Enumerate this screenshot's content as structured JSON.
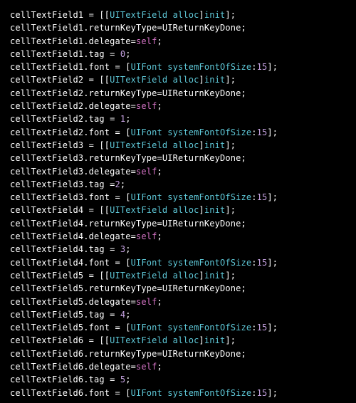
{
  "code": {
    "varPrefix": "cellTextField",
    "allocClass": "UITextField",
    "allocSel": "alloc",
    "initSel": "init",
    "returnKeyProp": "returnKeyType",
    "returnKeyValue": "UIReturnKeyDone",
    "delegateProp": "delegate",
    "selfKw": "self",
    "tagProp": "tag",
    "fontProp": "font",
    "fontClass": "UIFont",
    "fontSel": "systemFontOfSize",
    "fontSize": "15",
    "fields": [
      {
        "suffix": "1",
        "tag": "0",
        "tagSpace": " "
      },
      {
        "suffix": "2",
        "tag": "1",
        "tagSpace": " "
      },
      {
        "suffix": "3",
        "tag": "2",
        "tagSpace": ""
      },
      {
        "suffix": "4",
        "tag": "3",
        "tagSpace": " "
      },
      {
        "suffix": "5",
        "tag": "4",
        "tagSpace": " "
      },
      {
        "suffix": "6",
        "tag": "5",
        "tagSpace": " "
      }
    ]
  }
}
